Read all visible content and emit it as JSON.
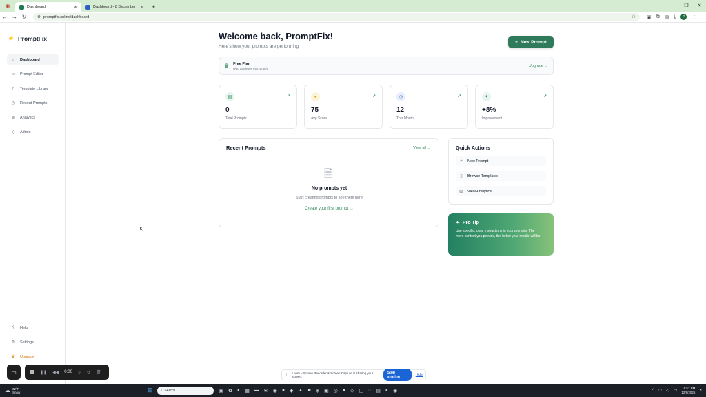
{
  "browser": {
    "tabs": [
      {
        "title": "Dashboard",
        "active": true
      },
      {
        "title": "Dashboard - 8 December 2025",
        "active": false
      }
    ],
    "url": "promptfix.online/dashboard"
  },
  "sidebar": {
    "brand": "PromptFix",
    "items": [
      {
        "label": "Dashboard",
        "icon": "home-icon",
        "active": true
      },
      {
        "label": "Prompt Editor",
        "icon": "edit-icon"
      },
      {
        "label": "Template Library",
        "icon": "book-icon"
      },
      {
        "label": "Recent Prompts",
        "icon": "clock-icon"
      },
      {
        "label": "Analytics",
        "icon": "chart-icon"
      },
      {
        "label": "Admin",
        "icon": "shield-icon"
      }
    ],
    "bottom_items": [
      {
        "label": "Help",
        "icon": "help-icon"
      },
      {
        "label": "Settings",
        "icon": "gear-icon"
      },
      {
        "label": "Upgrade",
        "icon": "crown-icon",
        "accent": "#d97706"
      }
    ]
  },
  "main": {
    "welcome": "Welcome back, PromptFix!",
    "subtitle": "Here's how your prompts are performing",
    "new_prompt_label": "New Prompt",
    "plan": {
      "title": "Free Plan",
      "sub": "0/30 analyses this month",
      "upgrade_label": "Upgrade →"
    },
    "stats": [
      {
        "value": "0",
        "label": "Total Prompts",
        "icon": "document-icon",
        "color": "#e8f5ee"
      },
      {
        "value": "75",
        "label": "Avg Score",
        "icon": "star-icon",
        "color": "#fdf3d8"
      },
      {
        "value": "12",
        "label": "This Month",
        "icon": "clock-icon",
        "color": "#e8eefb"
      },
      {
        "value": "+8%",
        "label": "Improvement",
        "icon": "sparkle-icon",
        "color": "#e8f5ee"
      }
    ],
    "recent": {
      "title": "Recent Prompts",
      "view_all": "View all →",
      "empty_title": "No prompts yet",
      "empty_sub": "Start creating prompts to see them here",
      "create_link": "Create your first prompt →"
    },
    "quick_actions": {
      "title": "Quick Actions",
      "items": [
        {
          "label": "New Prompt",
          "icon": "plus-icon"
        },
        {
          "label": "Browse Templates",
          "icon": "book-icon"
        },
        {
          "label": "View Analytics",
          "icon": "chart-icon"
        }
      ]
    },
    "protip": {
      "title": "Pro Tip",
      "text": "Use specific, clear instructions in your prompts. The more context you provide, the better your results will be."
    }
  },
  "recorder": {
    "time": "0:00"
  },
  "sharing": {
    "text": "Loom – Screen Recorder & Screen Capture is sharing your screen.",
    "stop_label": "Stop sharing",
    "hide_label": "Hide"
  },
  "taskbar": {
    "temp": "32°F",
    "weather": "Snow",
    "search_placeholder": "Search",
    "time": "6:57 PM",
    "date": "12/8/2025"
  }
}
